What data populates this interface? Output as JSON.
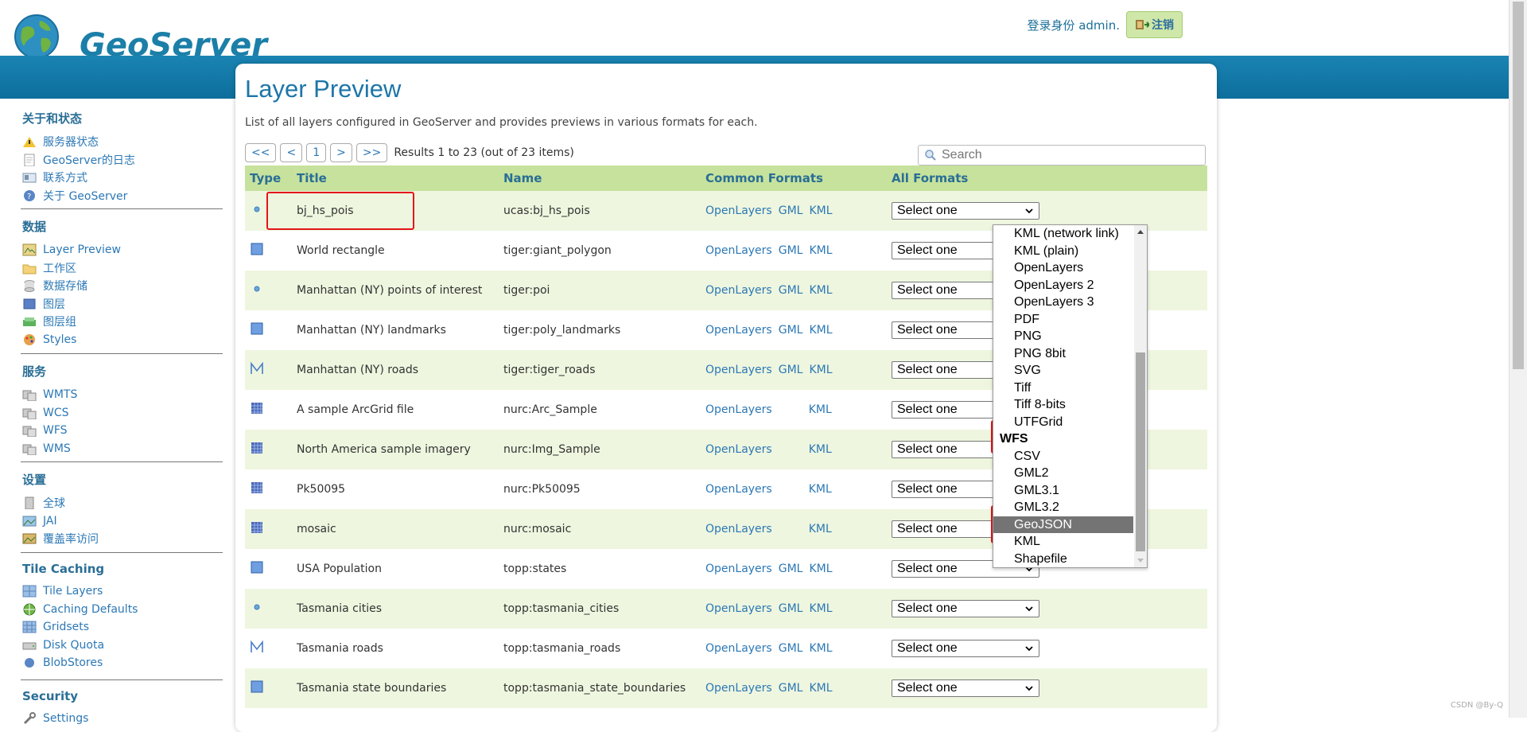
{
  "header": {
    "app_name": "GeoServer",
    "login_text": "登录身份 admin.",
    "logout_label": "注销"
  },
  "sidebar": {
    "sections": [
      {
        "title": "关于和状态",
        "items": [
          "服务器状态",
          "GeoServer的日志",
          "联系方式",
          "关于 GeoServer"
        ]
      },
      {
        "title": "数据",
        "items": [
          "Layer Preview",
          "工作区",
          "数据存储",
          "图层",
          "图层组",
          "Styles"
        ]
      },
      {
        "title": "服务",
        "items": [
          "WMTS",
          "WCS",
          "WFS",
          "WMS"
        ]
      },
      {
        "title": "设置",
        "items": [
          "全球",
          "JAI",
          "覆盖率访问"
        ]
      },
      {
        "title": "Tile Caching",
        "items": [
          "Tile Layers",
          "Caching Defaults",
          "Gridsets",
          "Disk Quota",
          "BlobStores"
        ]
      },
      {
        "title": "Security",
        "items": [
          "Settings"
        ]
      }
    ]
  },
  "main": {
    "title": "Layer Preview",
    "description": "List of all layers configured in GeoServer and provides previews in various formats for each.",
    "pager": {
      "first": "<<",
      "prev": "<",
      "page": "1",
      "next": ">",
      "last": ">>",
      "results": "Results 1 to 23 (out of 23 items)"
    },
    "search_placeholder": "Search",
    "columns": [
      "Type",
      "Title",
      "Name",
      "Common Formats",
      "All Formats"
    ],
    "select_placeholder": "Select one",
    "rows": [
      {
        "type": "point",
        "title": "bj_hs_pois",
        "name": "ucas:bj_hs_pois",
        "formats": [
          "OpenLayers",
          "GML",
          "KML"
        ]
      },
      {
        "type": "polygon",
        "title": "World rectangle",
        "name": "tiger:giant_polygon",
        "formats": [
          "OpenLayers",
          "GML",
          "KML"
        ]
      },
      {
        "type": "point",
        "title": "Manhattan (NY) points of interest",
        "name": "tiger:poi",
        "formats": [
          "OpenLayers",
          "GML",
          "KML"
        ]
      },
      {
        "type": "polygon",
        "title": "Manhattan (NY) landmarks",
        "name": "tiger:poly_landmarks",
        "formats": [
          "OpenLayers",
          "GML",
          "KML"
        ]
      },
      {
        "type": "line",
        "title": "Manhattan (NY) roads",
        "name": "tiger:tiger_roads",
        "formats": [
          "OpenLayers",
          "GML",
          "KML"
        ]
      },
      {
        "type": "raster",
        "title": "A sample ArcGrid file",
        "name": "nurc:Arc_Sample",
        "formats": [
          "OpenLayers",
          "",
          "KML"
        ]
      },
      {
        "type": "raster",
        "title": "North America sample imagery",
        "name": "nurc:Img_Sample",
        "formats": [
          "OpenLayers",
          "",
          "KML"
        ]
      },
      {
        "type": "raster",
        "title": "Pk50095",
        "name": "nurc:Pk50095",
        "formats": [
          "OpenLayers",
          "",
          "KML"
        ]
      },
      {
        "type": "raster",
        "title": "mosaic",
        "name": "nurc:mosaic",
        "formats": [
          "OpenLayers",
          "",
          "KML"
        ]
      },
      {
        "type": "polygon",
        "title": "USA Population",
        "name": "topp:states",
        "formats": [
          "OpenLayers",
          "GML",
          "KML"
        ]
      },
      {
        "type": "point",
        "title": "Tasmania cities",
        "name": "topp:tasmania_cities",
        "formats": [
          "OpenLayers",
          "GML",
          "KML"
        ]
      },
      {
        "type": "line",
        "title": "Tasmania roads",
        "name": "topp:tasmania_roads",
        "formats": [
          "OpenLayers",
          "GML",
          "KML"
        ]
      },
      {
        "type": "polygon",
        "title": "Tasmania state boundaries",
        "name": "topp:tasmania_state_boundaries",
        "formats": [
          "OpenLayers",
          "GML",
          "KML"
        ]
      }
    ]
  },
  "dropdown": {
    "options": [
      {
        "label": "KML (network link)"
      },
      {
        "label": "KML (plain)"
      },
      {
        "label": "OpenLayers"
      },
      {
        "label": "OpenLayers 2"
      },
      {
        "label": "OpenLayers 3"
      },
      {
        "label": "PDF"
      },
      {
        "label": "PNG"
      },
      {
        "label": "PNG 8bit"
      },
      {
        "label": "SVG"
      },
      {
        "label": "Tiff"
      },
      {
        "label": "Tiff 8-bits"
      },
      {
        "label": "UTFGrid"
      },
      {
        "label": "WFS",
        "group": true
      },
      {
        "label": "CSV"
      },
      {
        "label": "GML2"
      },
      {
        "label": "GML3.1"
      },
      {
        "label": "GML3.2"
      },
      {
        "label": "GeoJSON",
        "highlighted": true
      },
      {
        "label": "KML"
      },
      {
        "label": "Shapefile"
      }
    ]
  },
  "watermark": "CSDN @By-Q",
  "colors": {
    "accent": "#1b7fa8",
    "banner": "#0d6e9c",
    "table_header": "#c6e29c",
    "row_alt": "#eef6df",
    "highlight_box": "#e5141b"
  }
}
